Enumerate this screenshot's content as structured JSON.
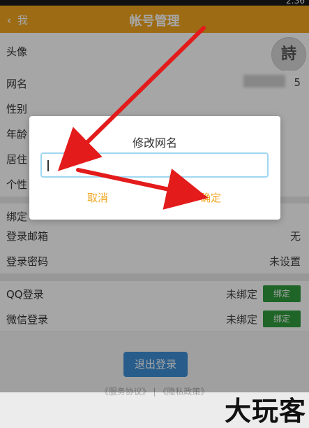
{
  "statusbar": {
    "time": "2:36"
  },
  "header": {
    "back_label": "我",
    "title": "帐号管理"
  },
  "profile_rows": [
    {
      "label": "头像"
    },
    {
      "label": "网名",
      "value": "5"
    },
    {
      "label": "性别"
    },
    {
      "label": "年龄"
    },
    {
      "label": "居住"
    },
    {
      "label": "个性"
    }
  ],
  "security_rows": [
    {
      "label": "绑定"
    },
    {
      "label": "登录邮箱",
      "value": "无"
    },
    {
      "label": "登录密码",
      "value": "未设置"
    }
  ],
  "social_rows": [
    {
      "label": "QQ登录",
      "status": "未绑定",
      "button": "绑定"
    },
    {
      "label": "微信登录",
      "status": "未绑定",
      "button": "绑定"
    }
  ],
  "avatar_char": "詩",
  "logout_label": "退出登录",
  "footer_text": "《服务协议》 | 《隐私政策》",
  "watermark": "大玩客",
  "dialog": {
    "title": "修改网名",
    "input_value": "",
    "cancel_label": "取消",
    "confirm_label": "确定"
  },
  "colors": {
    "header": "#f0a51f",
    "accent": "#f0a51f",
    "bind_button": "#2e9b3c",
    "logout_button": "#3e90d6",
    "annotation_arrow": "#e31b1b"
  }
}
